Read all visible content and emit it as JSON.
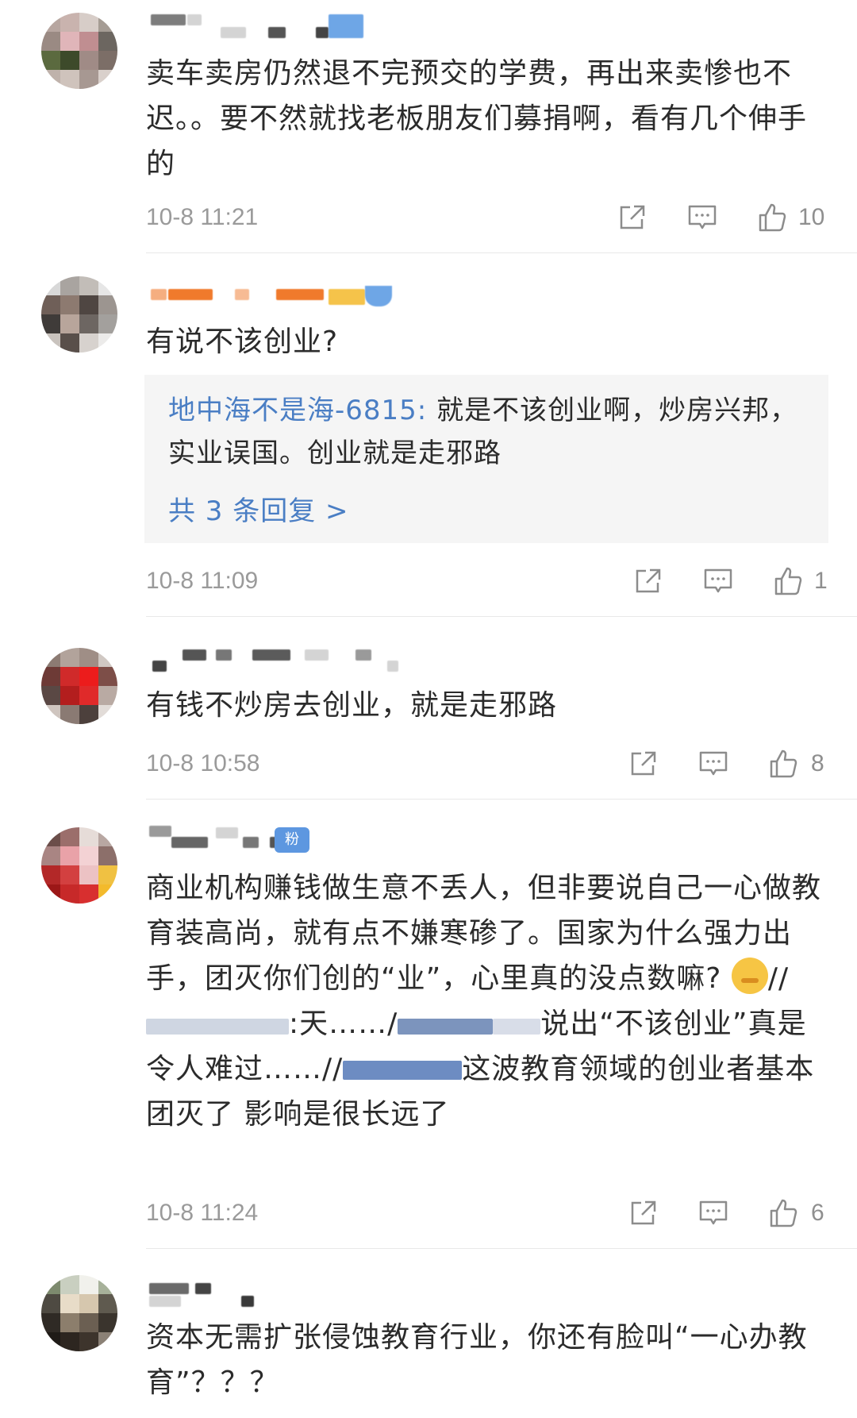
{
  "comments": [
    {
      "text": "卖车卖房仍然退不完预交的学费，再出来卖惨也不迟。。要不然就找老板朋友们募捐啊，看有几个伸手的",
      "time": "10-8 11:21",
      "likes": "10"
    },
    {
      "text": "有说不该创业?",
      "reply": {
        "name": "地中海不是海-6815:",
        "text": " 就是不该创业啊，炒房兴邦，实业误国。创业就是走邪路",
        "more": "共 3 条回复 >"
      },
      "time": "10-8 11:09",
      "likes": "1"
    },
    {
      "text": "有钱不炒房去创业，就是走邪路",
      "time": "10-8 10:58",
      "likes": "8"
    },
    {
      "badge": "粉",
      "text_part1": "商业机构赚钱做生意不丢人，但非要说自己一心做教育装高尚，就有点不嫌寒碜了。国家为什么强力出手，团灭你们创的“业”，心里真的没点数嘛?",
      "text_part2": "//",
      "text_part3": ":天……/",
      "text_part4": "说出“不该创业”真是令人难过……//",
      "text_part5": "这波教育领域的创业者基本团灭了 影响是很长远了",
      "time": "10-8 11:24",
      "likes": "6"
    },
    {
      "text": "资本无需扩张侵蚀教育行业，你还有脸叫“一心办教育”？？？"
    }
  ],
  "icons": {
    "share": "share-icon",
    "comment": "comment-icon",
    "like": "thumbs-up-icon",
    "emoji": "shush-face-emoji"
  },
  "colors": {
    "text": "#2b2b2b",
    "meta": "#9a9a9a",
    "link": "#4a7ec4",
    "reply_bg": "#f5f5f5"
  }
}
